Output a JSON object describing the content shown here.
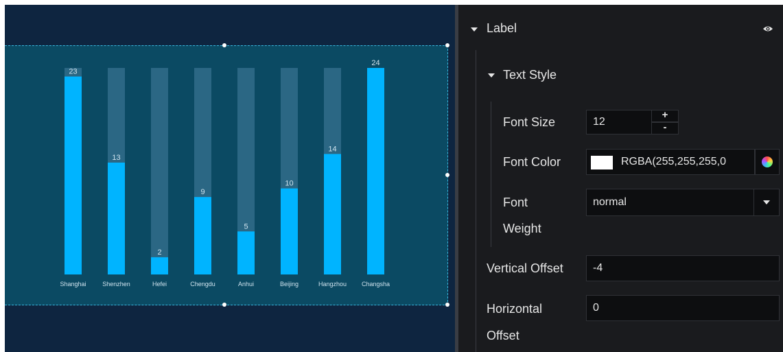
{
  "chart_data": {
    "type": "bar",
    "categories": [
      "Shanghai",
      "Shenzhen",
      "Hefei",
      "Chengdu",
      "Anhui",
      "Beijing",
      "Hangzhou",
      "Changsha"
    ],
    "values": [
      23,
      13,
      2,
      9,
      5,
      10,
      14,
      24
    ],
    "ylim": [
      0,
      24
    ],
    "bar_color": "#00b4ff",
    "track_color": "#2b6784",
    "label_color": "#cfe3ee",
    "title": "",
    "xlabel": "",
    "ylabel": "",
    "grid": false
  },
  "panel": {
    "label_section": {
      "title": "Label",
      "visibility_icon": "eye-icon"
    },
    "text_style": {
      "title": "Text Style"
    },
    "font_size": {
      "label": "Font Size",
      "value": "12",
      "increment": "+",
      "decrement": "-"
    },
    "font_color": {
      "label": "Font Color",
      "value": "RGBA(255,255,255,0",
      "swatch_color": "#ffffff",
      "picker_icon": "color-wheel-icon"
    },
    "font_weight": {
      "label_line1": "Font",
      "label_line2": "Weight",
      "value": "normal",
      "dropdown_icon": "chevron-down-icon"
    },
    "vertical_offset": {
      "label": "Vertical Offset",
      "value": "-4"
    },
    "horizontal_offset": {
      "label_line1": "Horizontal",
      "label_line2": "Offset",
      "value": "0"
    }
  },
  "colors": {
    "canvas_bg": "#0e2540",
    "widget_bg": "#0b4a63",
    "panel_bg": "#1a1b1e",
    "field_bg": "#0d0e10"
  }
}
